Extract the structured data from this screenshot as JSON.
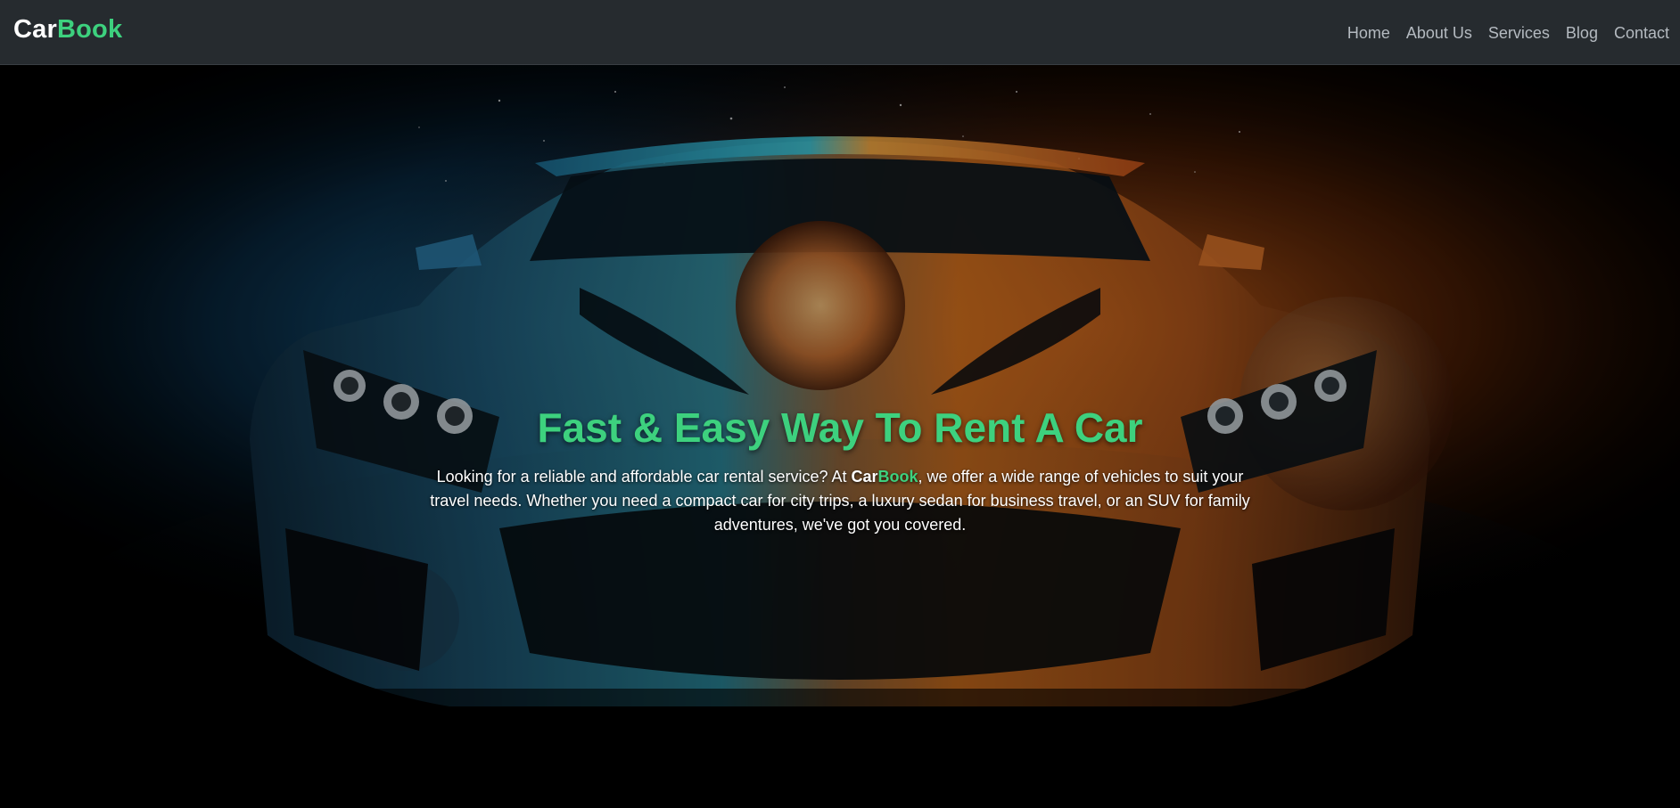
{
  "brand": {
    "part1": "Car",
    "part2": "Book"
  },
  "nav": {
    "items": [
      {
        "label": "Home"
      },
      {
        "label": "About Us"
      },
      {
        "label": "Services"
      },
      {
        "label": "Blog"
      },
      {
        "label": "Contact"
      }
    ]
  },
  "hero": {
    "title": "Fast & Easy Way To Rent A Car",
    "text_before": "Looking for a reliable and affordable car rental service? At ",
    "brand_part1": "Car",
    "brand_part2": "Book",
    "text_after": ", we offer a wide range of vehicles to suit your travel needs. Whether you need a compact car for city trips, a luxury sedan for business travel, or an SUV for family adventures, we've got you covered."
  },
  "colors": {
    "accent": "#3dd17e",
    "navbar_bg": "#262b2f",
    "nav_text": "#b4bac0",
    "hero_text": "#ffffff"
  }
}
